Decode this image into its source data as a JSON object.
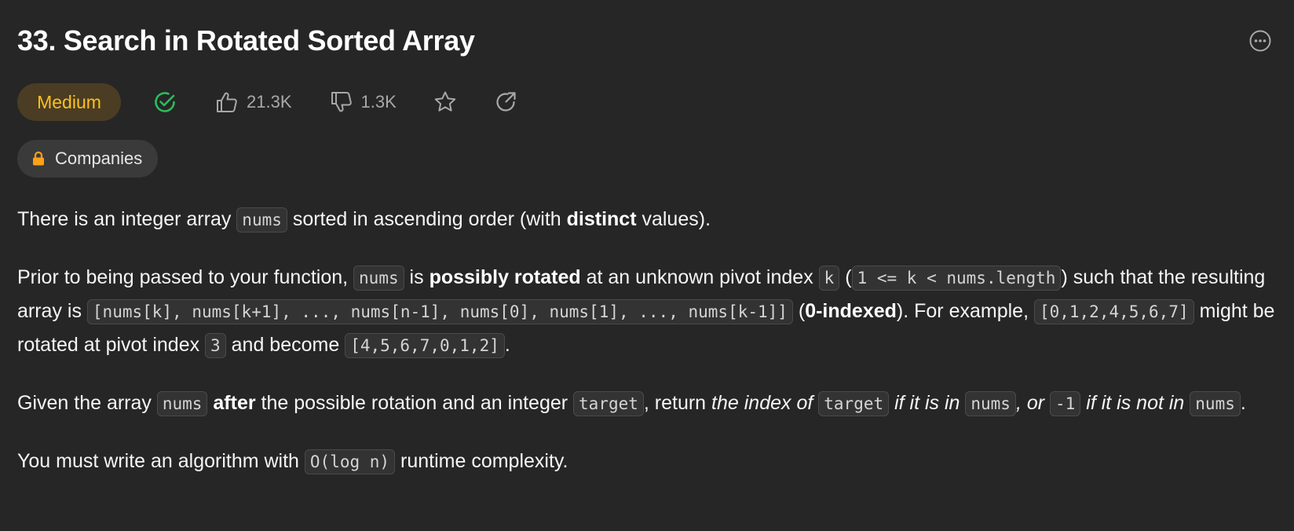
{
  "problem": {
    "title": "33. Search in Rotated Sorted Array",
    "difficulty": "Medium",
    "likes": "21.3K",
    "dislikes": "1.3K",
    "companies_label": "Companies"
  },
  "colors": {
    "background": "#262626",
    "difficulty_text": "#ffc01e",
    "difficulty_bg": "#4a3d24",
    "solved_check": "#2cbb5d",
    "lock": "#ffa116"
  },
  "icons": [
    "more-icon",
    "solved-check-icon",
    "thumbs-up-icon",
    "thumbs-down-icon",
    "star-icon",
    "share-icon",
    "lock-icon"
  ],
  "description": {
    "p1": {
      "t1": "There is an integer array ",
      "c1": "nums",
      "t2": " sorted in ascending order (with ",
      "b1": "distinct",
      "t3": " values)."
    },
    "p2": {
      "t1": "Prior to being passed to your function, ",
      "c1": "nums",
      "t2": " is ",
      "b1": "possibly rotated",
      "t3": " at an unknown pivot index ",
      "c2": "k",
      "t4": " (",
      "c3": "1 <= k < nums.length",
      "t5": ") such that the resulting array is ",
      "c4": "[nums[k], nums[k+1], ..., nums[n-1], nums[0], nums[1], ..., nums[k-1]]",
      "t6": " (",
      "b2": "0-indexed",
      "t7": "). For example, ",
      "c5": "[0,1,2,4,5,6,7]",
      "t8": " might be rotated at pivot index ",
      "c6": "3",
      "t9": " and become ",
      "c7": "[4,5,6,7,0,1,2]",
      "t10": "."
    },
    "p3": {
      "t1": "Given the array ",
      "c1": "nums",
      "t2": " ",
      "b1": "after",
      "t3": " the possible rotation and an integer ",
      "c2": "target",
      "t4": ", return ",
      "i1": "the index of ",
      "c3": "target",
      "i2": " if it is in ",
      "c4": "nums",
      "i3": ", or ",
      "c5": "-1",
      "i4": " if it is not in ",
      "c6": "nums",
      "t5": "."
    },
    "p4": {
      "t1": "You must write an algorithm with ",
      "c1": "O(log n)",
      "t2": " runtime complexity."
    }
  }
}
